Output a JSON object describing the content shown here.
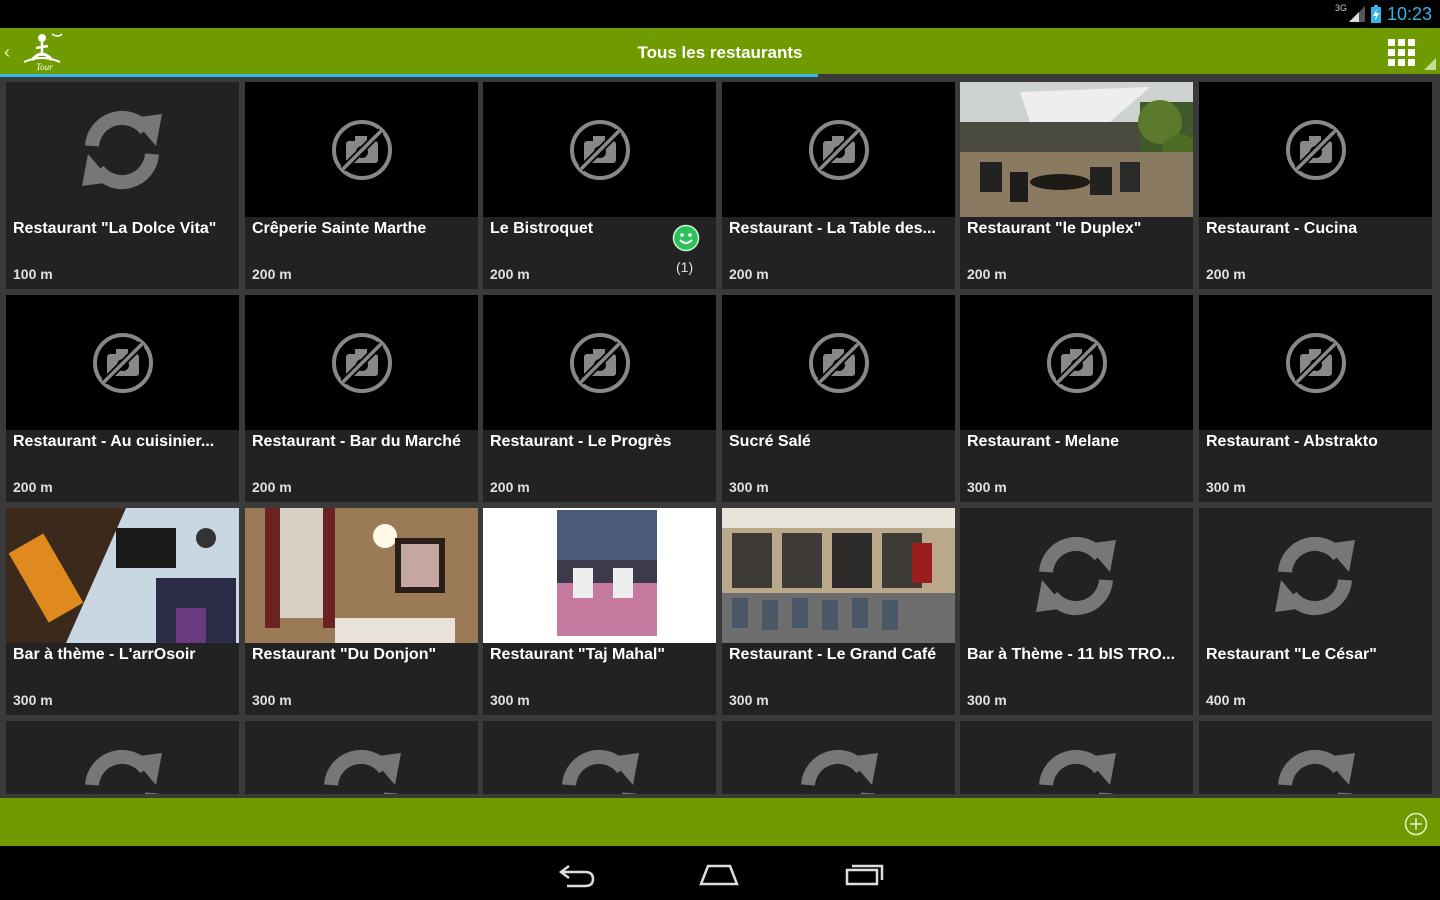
{
  "status": {
    "network": "3G",
    "time": "10:23"
  },
  "header": {
    "title": "Tous les restaurants",
    "logo_text": "Tour"
  },
  "restaurants": [
    {
      "name": "Restaurant \"La Dolce Vita\"",
      "distance": "100 m",
      "thumb": "loading"
    },
    {
      "name": "Crêperie Sainte Marthe",
      "distance": "200 m",
      "thumb": "none"
    },
    {
      "name": "Le Bistroquet",
      "distance": "200 m",
      "thumb": "none",
      "rating_count": "(1)"
    },
    {
      "name": "Restaurant - La Table des...",
      "distance": "200 m",
      "thumb": "none"
    },
    {
      "name": "Restaurant \"le Duplex\"",
      "distance": "200 m",
      "thumb": "photo-terrace"
    },
    {
      "name": "Restaurant - Cucina",
      "distance": "200 m",
      "thumb": "none"
    },
    {
      "name": "Restaurant - Au cuisinier...",
      "distance": "200 m",
      "thumb": "none"
    },
    {
      "name": "Restaurant - Bar du Marché",
      "distance": "200 m",
      "thumb": "none"
    },
    {
      "name": "Restaurant - Le Progrès",
      "distance": "200 m",
      "thumb": "none"
    },
    {
      "name": "Sucré Salé",
      "distance": "300 m",
      "thumb": "none"
    },
    {
      "name": "Restaurant - Melane",
      "distance": "300 m",
      "thumb": "none"
    },
    {
      "name": "Restaurant - Abstrakto",
      "distance": "300 m",
      "thumb": "none"
    },
    {
      "name": "Bar à thème - L'arrOsoir",
      "distance": "300 m",
      "thumb": "photo-bar"
    },
    {
      "name": "Restaurant \"Du Donjon\"",
      "distance": "300 m",
      "thumb": "photo-dining"
    },
    {
      "name": "Restaurant \"Taj Mahal\"",
      "distance": "300 m",
      "thumb": "photo-tables"
    },
    {
      "name": "Restaurant - Le Grand Café",
      "distance": "300 m",
      "thumb": "photo-cafe"
    },
    {
      "name": "Bar à Thème - 11 bIS TRO...",
      "distance": "300 m",
      "thumb": "loading"
    },
    {
      "name": "Restaurant \"Le César\"",
      "distance": "400 m",
      "thumb": "loading"
    },
    {
      "name": "",
      "distance": "",
      "thumb": "loading"
    },
    {
      "name": "",
      "distance": "",
      "thumb": "loading"
    },
    {
      "name": "",
      "distance": "",
      "thumb": "loading"
    },
    {
      "name": "",
      "distance": "",
      "thumb": "loading"
    },
    {
      "name": "",
      "distance": "",
      "thumb": "loading"
    },
    {
      "name": "",
      "distance": "",
      "thumb": "loading"
    }
  ],
  "icons": {
    "back": "chevron-left-icon",
    "grid": "grid-view-icon",
    "add": "add-circle-icon",
    "no_photo": "no-photo-icon",
    "loading": "refresh-icon",
    "rating": "smiley-icon"
  },
  "colors": {
    "accent_green": "#6f9a00",
    "holo_blue": "#33b5e5",
    "tile_bg": "#222222"
  }
}
